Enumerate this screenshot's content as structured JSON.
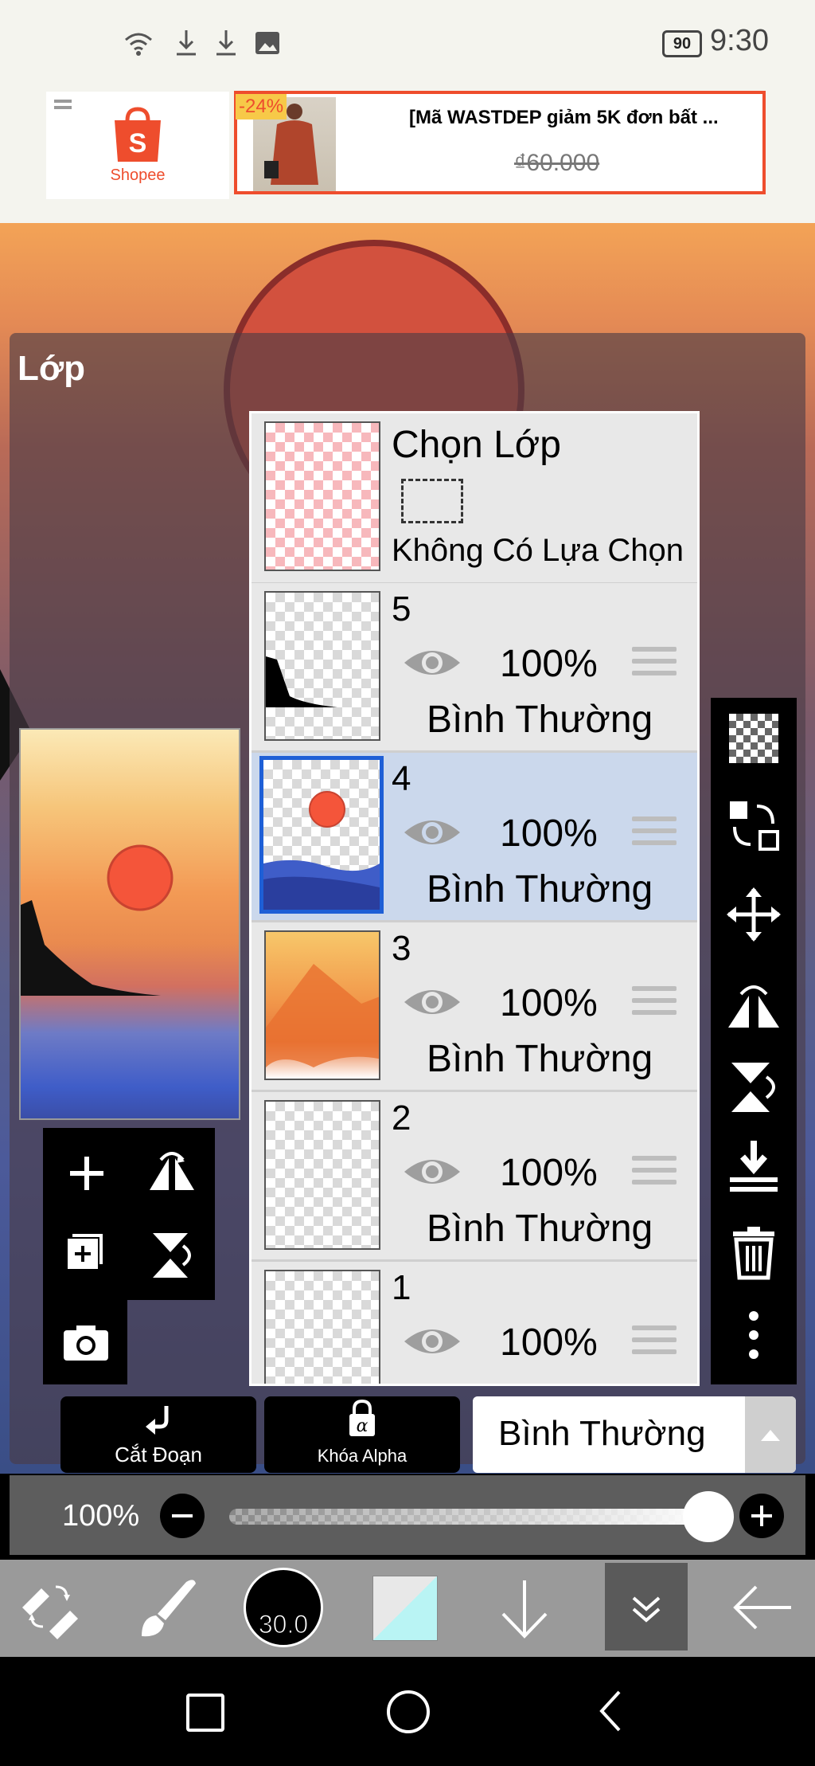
{
  "status_bar": {
    "battery": "90",
    "time": "9:30"
  },
  "ad": {
    "brand": "Shopee",
    "discount": "-24%",
    "product_title": "[Mã WASTDEP giảm 5K đơn bất ...",
    "price": "₫60.000"
  },
  "layer_panel": {
    "title": "Lớp",
    "selection_row": {
      "title": "Chọn Lớp",
      "status": "Không Có Lựa Chọn"
    },
    "layers": [
      {
        "number": "5",
        "opacity": "100%",
        "blend": "Bình Thường",
        "selected": false
      },
      {
        "number": "4",
        "opacity": "100%",
        "blend": "Bình Thường",
        "selected": true
      },
      {
        "number": "3",
        "opacity": "100%",
        "blend": "Bình Thường",
        "selected": false
      },
      {
        "number": "2",
        "opacity": "100%",
        "blend": "Bình Thường",
        "selected": false
      },
      {
        "number": "1",
        "opacity": "100%",
        "blend": "",
        "selected": false
      }
    ],
    "clip_label": "Cắt Đoạn",
    "alpha_lock_label": "Khóa Alpha",
    "blend_mode": "Bình Thường",
    "opacity_label": "100%",
    "opacity_value": 1.0
  },
  "bottom_toolbar": {
    "brush_size": "30.0"
  },
  "colors": {
    "accent_red": "#ee4d2d",
    "selected_row": "#cbd8ec",
    "sun": "#f4553a"
  }
}
